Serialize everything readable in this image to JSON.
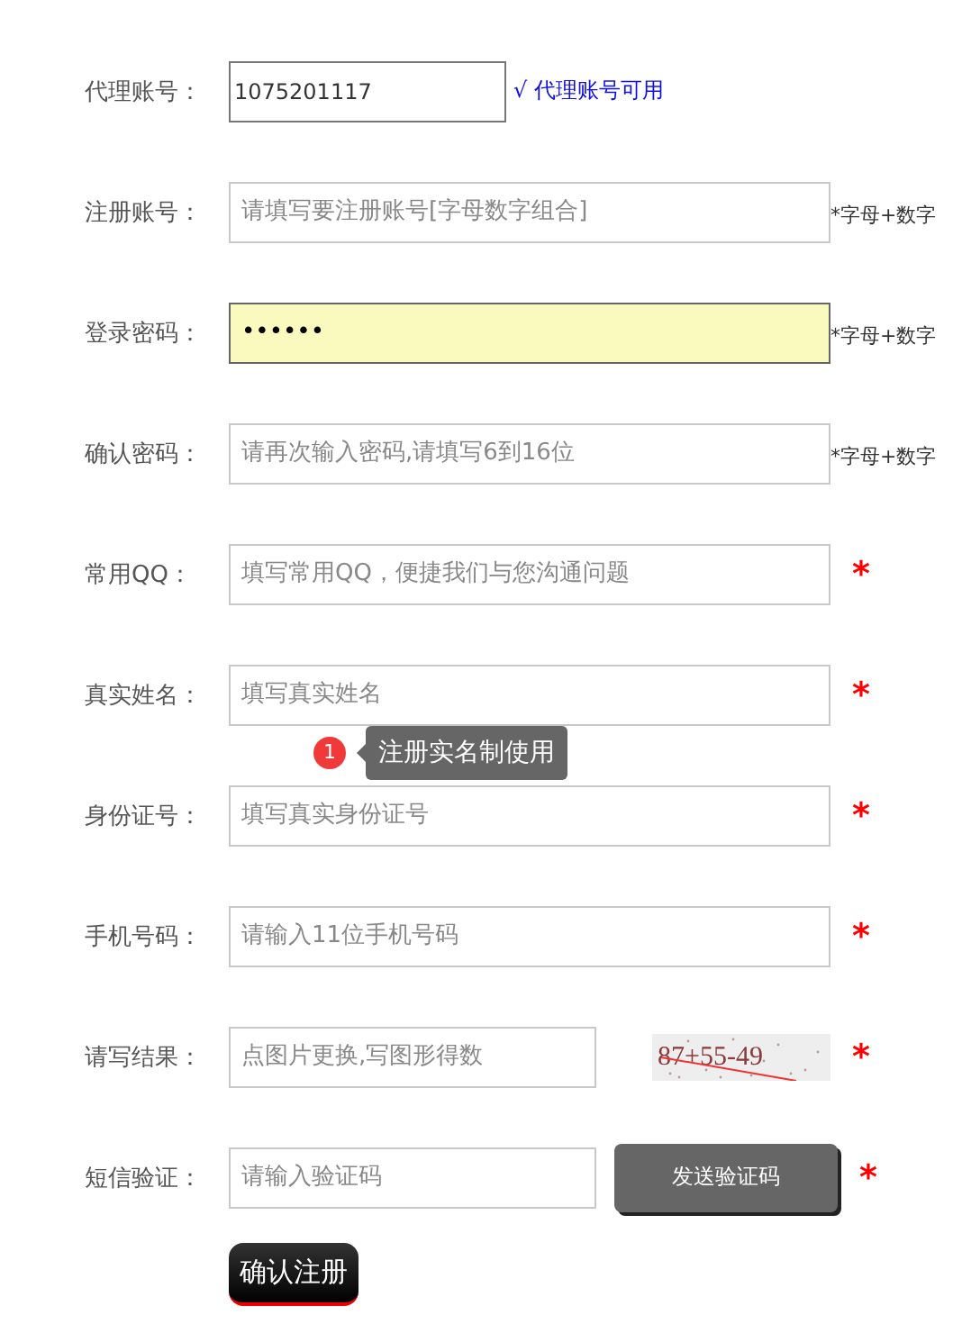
{
  "fields": [
    {
      "kind": "agent",
      "label": "代理账号：",
      "value": "1075201117",
      "status": "√ 代理账号可用"
    },
    {
      "kind": "input",
      "label": "注册账号：",
      "placeholder": "请填写要注册账号[字母数字组合]",
      "note": "*字母+数字"
    },
    {
      "kind": "input",
      "label": "登录密码：",
      "value": "••••••",
      "focused": true,
      "note": "*字母+数字"
    },
    {
      "kind": "input",
      "label": "确认密码：",
      "placeholder": "请再次输入密码,请填写6到16位",
      "note": "*字母+数字"
    },
    {
      "kind": "input",
      "label": "常用QQ：",
      "placeholder": "填写常用QQ，便捷我们与您沟通问题",
      "star": "*"
    },
    {
      "kind": "input",
      "label": "真实姓名：",
      "placeholder": "填写真实姓名",
      "star": "*",
      "tooltip": {
        "badge": "1",
        "text": "注册实名制使用"
      }
    },
    {
      "kind": "input",
      "label": "身份证号：",
      "placeholder": "填写真实身份证号",
      "star": "*"
    },
    {
      "kind": "input",
      "label": "手机号码：",
      "placeholder": "请输入11位手机号码",
      "star": "*"
    },
    {
      "kind": "captcha",
      "label": "请写结果：",
      "placeholder": "点图片更换,写图形得数",
      "captcha": "87+55-49",
      "star": "*"
    },
    {
      "kind": "sms",
      "label": "短信验证：",
      "placeholder": "请输入验证码",
      "button": "发送验证码",
      "star": "*"
    }
  ],
  "submit": "确认注册"
}
